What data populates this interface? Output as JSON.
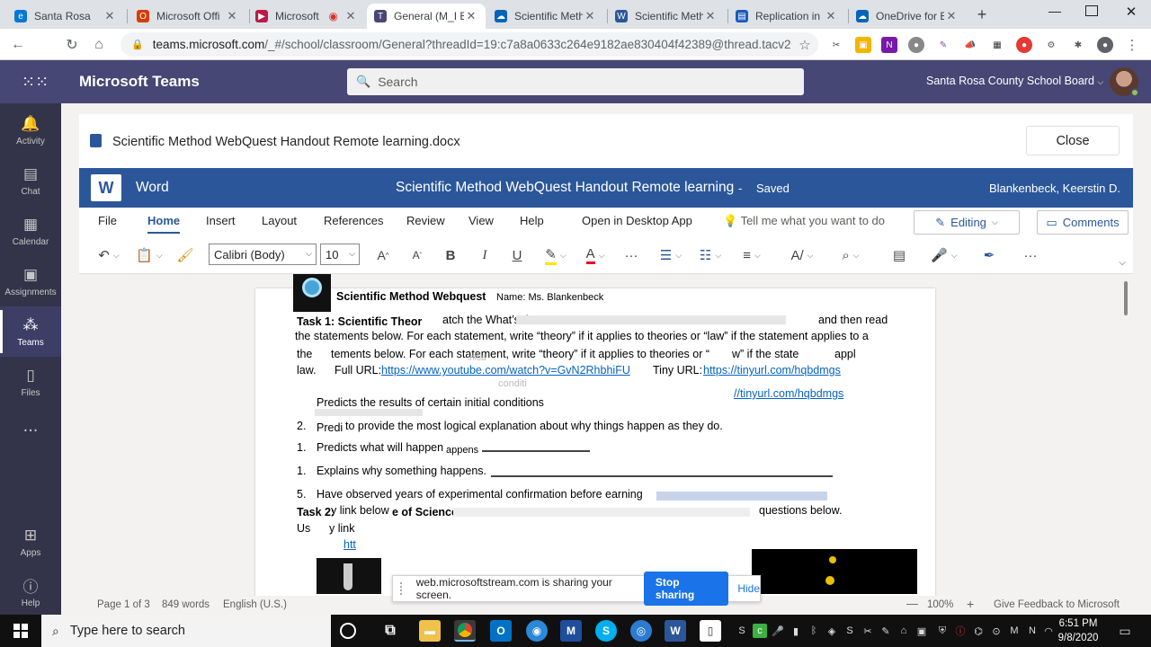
{
  "browser": {
    "tabs": [
      {
        "label": "Santa Rosa",
        "icon": "edge-tab-icon",
        "color": "#0078d4"
      },
      {
        "label": "Microsoft Offi",
        "icon": "office-tab-icon",
        "color": "#d83b01"
      },
      {
        "label": "Microsoft",
        "icon": "stream-tab-icon",
        "color": "#bc1948"
      },
      {
        "label": "General (M_I E",
        "icon": "teams-tab-icon",
        "color": "#464775"
      },
      {
        "label": "Scientific Meth",
        "icon": "onedrive-tab-icon",
        "color": "#0364b8"
      },
      {
        "label": "Scientific Meth",
        "icon": "word-tab-icon",
        "color": "#2b579a"
      },
      {
        "label": "Replication in",
        "icon": "forms-tab-icon",
        "color": "#185abd"
      },
      {
        "label": "OneDrive for B",
        "icon": "onedrive-tab-icon",
        "color": "#0364b8"
      }
    ],
    "url_host": "teams.microsoft.com",
    "url_path": "/_#/school/classroom/General?threadId=19:c7a8a0633c264e9182ae830404f42389@thread.tacv2&c..."
  },
  "teams": {
    "app_title": "Microsoft Teams",
    "search_placeholder": "Search",
    "org_name": "Santa Rosa County School Board",
    "rail": [
      {
        "label": "Activity"
      },
      {
        "label": "Chat"
      },
      {
        "label": "Calendar"
      },
      {
        "label": "Assignments"
      },
      {
        "label": "Teams"
      },
      {
        "label": "Files"
      },
      {
        "label": "..."
      },
      {
        "label": "Apps"
      },
      {
        "label": "Help"
      }
    ]
  },
  "document": {
    "file_name": "Scientific Method WebQuest Handout Remote learning.docx",
    "close_label": "Close"
  },
  "word": {
    "app_name": "Word",
    "doc_title": "Scientific Method WebQuest Handout Remote learning",
    "separator": "-",
    "save_status": "Saved",
    "user_name": "Blankenbeck, Keerstin D.",
    "ribbon_tabs": [
      "File",
      "Home",
      "Insert",
      "Layout",
      "References",
      "Review",
      "View",
      "Help",
      "Open in Desktop App"
    ],
    "tell_me": "Tell me what you want to do",
    "editing_label": "Editing",
    "comments_label": "Comments",
    "font_name": "Calibri (Body)",
    "font_size": "10"
  },
  "page_text": {
    "heading": "Scientific Method Webquest",
    "name_field": "Name: Ms. Blankenbeck",
    "task1_title": "Task 1: Scientific Theor",
    "task1_frag": "atch the What’s the",
    "task1_frag2": "and then read",
    "line2": "the statements below. For each statement, write “theory” if it applies to theories or “law” if the statement applies to a",
    "line3a": "the",
    "line3b": "tements below. For each statement, write “theory” if it applies to theories or “",
    "line3c": "w” if the state",
    "line3d": "appl",
    "line4a": "law.",
    "line4b": "Full URL:",
    "full_url": "https://www.youtube.com/watch?v=GvN2RhbhiFU",
    "line4c": "Tiny URL:",
    "tiny_url": "https://tinyurl.com/hqbdmgs",
    "tiny_url2": "//tinyurl.com/hqbdmgs",
    "item1": "Predicts the results of certain initial conditions",
    "item2": "to provide the most logical explanation about why things happen as they do.",
    "item2_prefix": "Predi",
    "item3": "Predicts what will happen",
    "item3_frag": "appens",
    "item4": "Explains why something happens.",
    "item5": "Have observed years of experimental confirmation before earning",
    "task2_title_a": "Task 2:",
    "task2_frag": "y link below",
    "task2_title_b": "e of Science",
    "task2_frag2": "questions below.",
    "us_frag": "Us",
    "link_frag": "y link",
    "url_frag": "htt",
    "initial_frag": "initia",
    "cond_frag": "conditi",
    "num1": "1.",
    "num2": "2.",
    "num3": "1.",
    "num4": "1.",
    "num5": "5."
  },
  "status_bar": {
    "page": "Page 1 of 3",
    "words": "849 words",
    "language": "English (U.S.)",
    "zoom": "100%",
    "feedback": "Give Feedback to Microsoft"
  },
  "share_notice": {
    "message": "web.microsoftstream.com is sharing your screen.",
    "stop_label": "Stop sharing",
    "hide_label": "Hide"
  },
  "taskbar": {
    "search_placeholder": "Type here to search",
    "time": "6:51 PM",
    "date": "9/8/2020"
  },
  "colors": {
    "teams_purple": "#464775",
    "word_blue": "#2b579a",
    "rail": "#33344a"
  }
}
